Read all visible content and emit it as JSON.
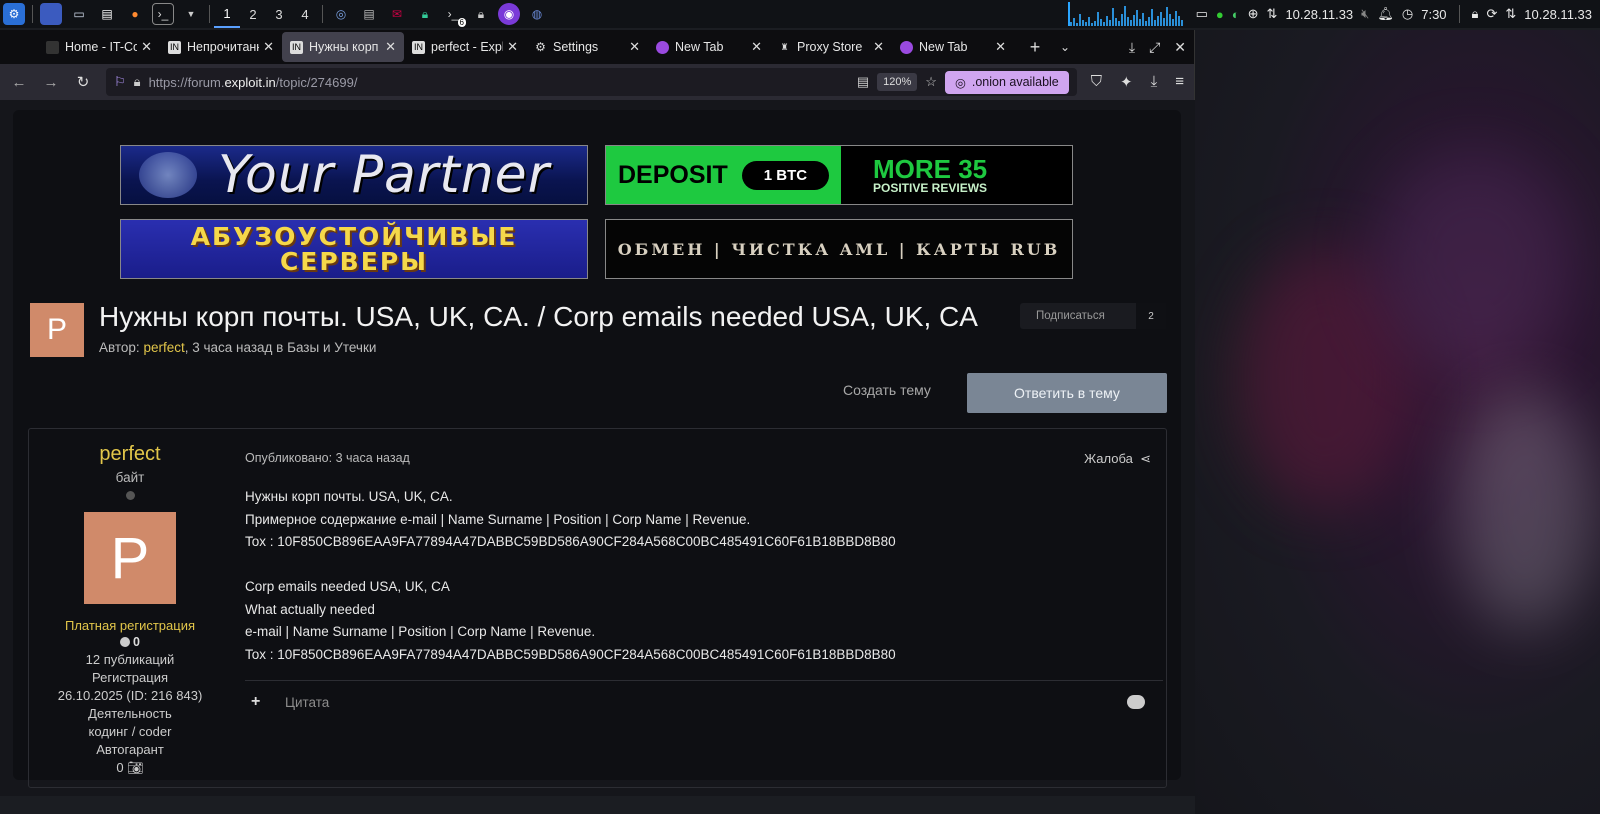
{
  "taskbar": {
    "workspaces": [
      "1",
      "2",
      "3",
      "4"
    ],
    "terminal_badge": "6",
    "ip_left": "10.28.11.33",
    "clock": "7:30",
    "ip_right": "10.28.11.33"
  },
  "tabs": [
    {
      "label": "Home - IT-Con",
      "favicon": "page-icon"
    },
    {
      "label": "Непрочитанно",
      "favicon": "IN"
    },
    {
      "label": "Нужны корп п",
      "favicon": "IN",
      "active": true
    },
    {
      "label": "perfect - Explo",
      "favicon": "IN"
    },
    {
      "label": "Settings",
      "favicon": "gear-icon"
    },
    {
      "label": "New Tab",
      "favicon": "tor-icon"
    },
    {
      "label": "Proxy Store",
      "favicon": "proxy-icon"
    },
    {
      "label": "New Tab",
      "favicon": "tor-icon"
    }
  ],
  "navbar": {
    "url_prefix": "https://forum.",
    "url_domain": "exploit.in",
    "url_path": "/topic/274699/",
    "zoom": "120%",
    "onion": ".onion available"
  },
  "banners": {
    "b1": "Your Partner",
    "b2_deposit": "DEPOSIT",
    "b2_btc": "1 BTC",
    "b2_more": "MORE 35",
    "b2_reviews": "POSITIVE REVIEWS",
    "b3_line1": "АБУЗОУСТОЙЧИВЫЕ",
    "b3_line2": "СЕРВЕРЫ",
    "b4": "ОБМЕН | ЧИСТКА AML | КАРТЫ RUB"
  },
  "topic": {
    "avatar_letter": "P",
    "title": "Нужны корп почты. USA, UK, CA. / Corp emails needed USA, UK, CA",
    "meta_prefix": "Автор: ",
    "author": "perfect",
    "meta_suffix": ", 3 часа назад в Базы и Утечки",
    "follow_label": "Подписаться",
    "follow_count": "2",
    "create_topic": "Создать тему",
    "reply_topic": "Ответить в тему"
  },
  "post": {
    "author": {
      "name": "perfect",
      "rank": "байт",
      "avatar_letter": "P",
      "group": "Платная регистрация",
      "reputation": "0",
      "posts": "12 публикаций",
      "reg_label": "Регистрация",
      "reg_date": "26.10.2025 (ID: 216 843)",
      "activity_label": "Деятельность",
      "activity": "кодинг / coder",
      "guarantee_label": "Автогарант",
      "guarantee_value": "0"
    },
    "date": "Опубликовано: 3 часа назад",
    "report": "Жалоба",
    "lines": [
      "Нужны корп почты. USA, UK, CA.",
      "Примерное содержание e-mail | Name Surname | Position | Corp Name | Revenue.",
      "Tox : 10F850CB896EAA9FA77894A47DABBC59BD586A90CF284A568C00BC485491C60F61B18BBD8B80",
      "",
      "Corp emails needed USA, UK, CA",
      "What actually needed",
      "e-mail | Name Surname | Position | Corp Name | Revenue.",
      "Tox : 10F850CB896EAA9FA77894A47DABBC59BD586A90CF284A568C00BC485491C60F61B18BBD8B80"
    ],
    "quote": "Цитата"
  }
}
